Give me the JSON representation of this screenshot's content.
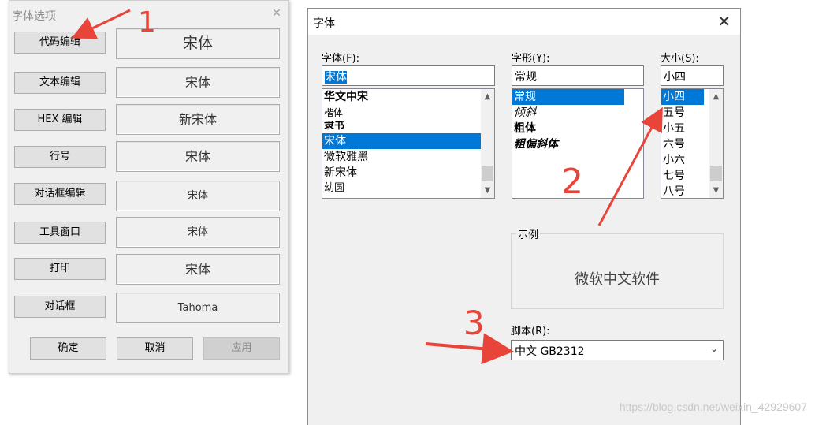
{
  "left_dialog": {
    "title": "字体选项",
    "close_glyph": "✕",
    "rows": [
      {
        "button": "代码编辑",
        "preview": "宋体"
      },
      {
        "button": "文本编辑",
        "preview": "宋体"
      },
      {
        "button": "HEX 编辑",
        "preview": "新宋体"
      },
      {
        "button": "行号",
        "preview": "宋体"
      },
      {
        "button": "对话框编辑",
        "preview": "宋体"
      },
      {
        "button": "工具窗口",
        "preview": "宋体"
      },
      {
        "button": "打印",
        "preview": "宋体"
      },
      {
        "button": "对话框",
        "preview": "Tahoma"
      }
    ],
    "ok": "确定",
    "cancel": "取消",
    "apply": "应用"
  },
  "font_dialog": {
    "title": "字体",
    "close_glyph": "✕",
    "font": {
      "label": "字体(F):",
      "value": "宋体",
      "items": [
        "华文中宋",
        "楷体",
        "隶书",
        "宋体",
        "微软雅黑",
        "新宋体",
        "幼圆"
      ],
      "selected_index": 3
    },
    "style": {
      "label": "字形(Y):",
      "value": "常规",
      "items": [
        "常规",
        "倾斜",
        "粗体",
        "粗偏斜体"
      ],
      "selected_index": 0
    },
    "size": {
      "label": "大小(S):",
      "value": "小四",
      "items": [
        "小四",
        "五号",
        "小五",
        "六号",
        "小六",
        "七号",
        "八号"
      ],
      "selected_index": 0
    },
    "sample": {
      "label": "示例",
      "text": "微软中文软件"
    },
    "script": {
      "label": "脚本(R):",
      "value": "中文 GB2312"
    }
  },
  "annotations": {
    "one": "1",
    "two": "2",
    "three": "3",
    "color": "#e8443a"
  },
  "watermark": "https://blog.csdn.net/weixin_42929607"
}
